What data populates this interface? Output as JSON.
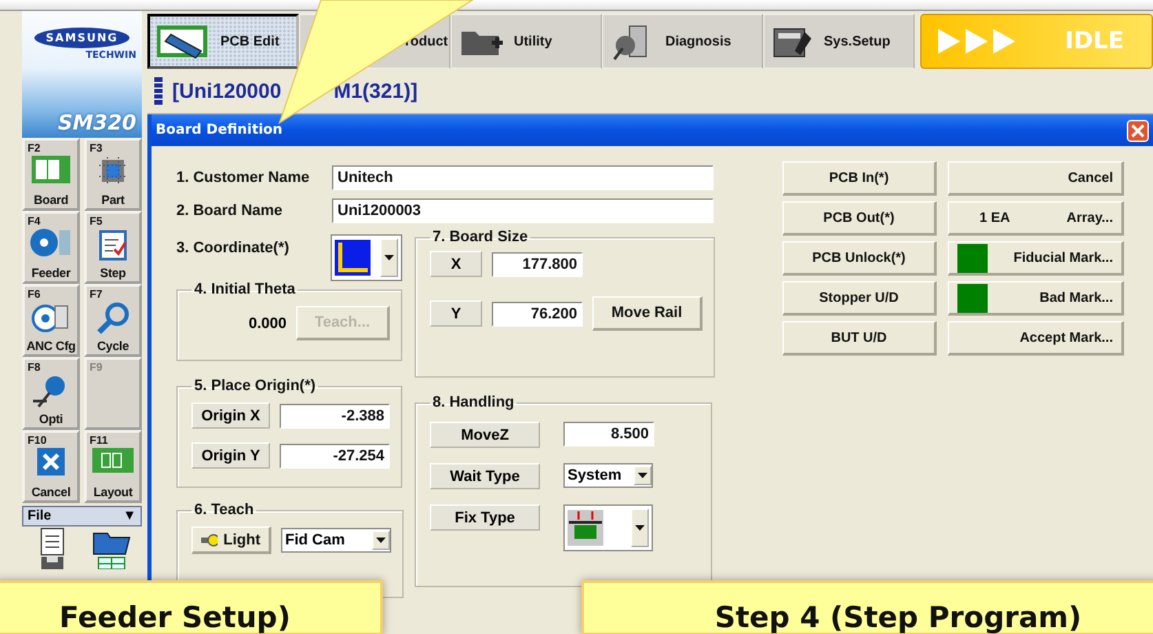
{
  "logo": {
    "brand": "SAMSUNG",
    "sub": "TECHWIN",
    "model": "SM320"
  },
  "toolbar": {
    "tabs": [
      {
        "label": "PCB Edit",
        "selected": true
      },
      {
        "label": "roduct",
        "selected": false
      },
      {
        "label": "Utility",
        "selected": false
      },
      {
        "label": "Diagnosis",
        "selected": false
      },
      {
        "label": "Sys.Setup",
        "selected": false
      }
    ],
    "status": {
      "label": "IDLE"
    }
  },
  "job_title": {
    "head": "[Uni120000",
    "tail": "M1(321)]"
  },
  "function_keys": [
    {
      "key": "F2",
      "label": "Board",
      "disabled": false
    },
    {
      "key": "F3",
      "label": "Part",
      "disabled": false
    },
    {
      "key": "F4",
      "label": "Feeder",
      "disabled": false
    },
    {
      "key": "F5",
      "label": "Step",
      "disabled": false
    },
    {
      "key": "F6",
      "label": "ANC Cfg",
      "disabled": false
    },
    {
      "key": "F7",
      "label": "Cycle",
      "disabled": false
    },
    {
      "key": "F8",
      "label": "Opti",
      "disabled": false
    },
    {
      "key": "F9",
      "disabled": true
    },
    {
      "key": "F10",
      "label": "Cancel",
      "disabled": false
    },
    {
      "key": "F11",
      "label": "Layout",
      "disabled": false
    }
  ],
  "file_menu": {
    "label": "File",
    "arrow": "▼"
  },
  "dialog": {
    "title": "Board Definition",
    "customer_name": {
      "label": "1. Customer Name",
      "value": "Unitech"
    },
    "board_name": {
      "label": "2. Board Name",
      "value": "Uni1200003"
    },
    "coordinate": {
      "label": "3. Coordinate(*)"
    },
    "initial_theta": {
      "title": "4. Initial Theta",
      "value": "0.000",
      "button": {
        "label": "Teach...",
        "disabled": true
      }
    },
    "place_origin": {
      "title": "5. Place Origin(*)",
      "rows": [
        {
          "label": "Origin X",
          "value": "-2.388"
        },
        {
          "label": "Origin Y",
          "value": "-27.254"
        }
      ]
    },
    "teach": {
      "title": "6. Teach",
      "light": "Light",
      "camera": "Fid Cam"
    },
    "board_size": {
      "title": "7. Board Size",
      "rows": [
        {
          "label": "X",
          "value": "177.800"
        },
        {
          "label": "Y",
          "value": "76.200"
        }
      ],
      "button": "Move Rail"
    },
    "handling": {
      "title": "8. Handling",
      "rows": [
        {
          "kind": "field",
          "label": "MoveZ",
          "value": "8.500"
        },
        {
          "kind": "select",
          "label": "Wait Type",
          "value": "System"
        },
        {
          "kind": "icon-select",
          "label": "Fix Type"
        }
      ]
    },
    "actions_left": [
      {
        "label": "PCB In(*)"
      },
      {
        "label": "PCB Out(*)"
      },
      {
        "label": "PCB Unlock(*)"
      },
      {
        "label": "Stopper U/D"
      },
      {
        "label": "BUT U/D"
      }
    ],
    "actions_right": [
      {
        "label": "Cancel"
      },
      {
        "label": "Array...",
        "count": "1 EA"
      },
      {
        "label": "Fiducial Mark...",
        "color": "#008000"
      },
      {
        "label": "Bad Mark...",
        "color": "#008000"
      },
      {
        "label": "Accept Mark..."
      }
    ]
  },
  "callouts": [
    {
      "text": "Feeder Setup)"
    },
    {
      "text": "Step 4 (Step Program)"
    }
  ]
}
